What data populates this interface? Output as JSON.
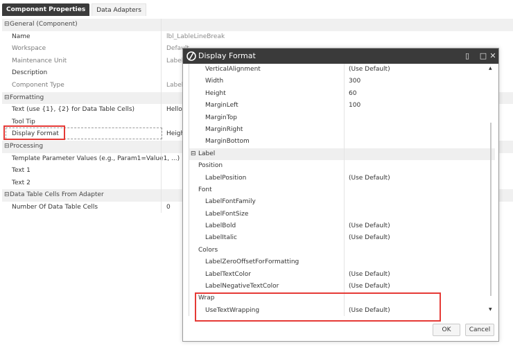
{
  "tabs": [
    {
      "label": "Component Properties"
    },
    {
      "label": "Data Adapters"
    }
  ],
  "properties": {
    "general": {
      "label": "General (Component)",
      "rows": [
        {
          "name": "Name",
          "value": "lbl_LableLineBreak"
        },
        {
          "name": "Workspace",
          "value": "Default"
        },
        {
          "name": "Maintenance Unit",
          "value": "Label"
        },
        {
          "name": "Description",
          "value": ""
        },
        {
          "name": "Component Type",
          "value": "Label"
        }
      ]
    },
    "formatting": {
      "label": "Formatting",
      "rows": [
        {
          "name": "Text (use {1}, {2} for Data Table Cells)",
          "value": "Hello,"
        },
        {
          "name": "Tool Tip",
          "value": ""
        },
        {
          "name": "Display Format",
          "value": "Heigh"
        }
      ]
    },
    "processing": {
      "label": "Processing",
      "rows": [
        {
          "name": "Template Parameter Values (e.g., Param1=Value1, ...)",
          "value": ""
        },
        {
          "name": "Text 1",
          "value": ""
        },
        {
          "name": "Text 2",
          "value": ""
        }
      ]
    },
    "datatable": {
      "label": "Data Table Cells From Adapter",
      "rows": [
        {
          "name": "Number Of Data Table Cells",
          "value": "0"
        }
      ]
    }
  },
  "dialog": {
    "title": "Display Format",
    "rows": {
      "vertical_alignment": {
        "name": "VerticalAlignment",
        "value": "(Use Default)"
      },
      "width": {
        "name": "Width",
        "value": "300"
      },
      "height": {
        "name": "Height",
        "value": "60"
      },
      "margin_left": {
        "name": "MarginLeft",
        "value": "100"
      },
      "margin_top": {
        "name": "MarginTop",
        "value": ""
      },
      "margin_right": {
        "name": "MarginRight",
        "value": ""
      },
      "margin_bottom": {
        "name": "MarginBottom",
        "value": ""
      },
      "label_category": "Label",
      "position_group": "Position",
      "label_position": {
        "name": "LabelPosition",
        "value": "(Use Default)"
      },
      "font_group": "Font",
      "label_font_family": {
        "name": "LabelFontFamily",
        "value": ""
      },
      "label_font_size": {
        "name": "LabelFontSize",
        "value": ""
      },
      "label_bold": {
        "name": "LabelBold",
        "value": "(Use Default)"
      },
      "label_italic": {
        "name": "LabelItalic",
        "value": "(Use Default)"
      },
      "colors_group": "Colors",
      "label_zero_offset": {
        "name": "LabelZeroOffsetForFormatting",
        "value": ""
      },
      "label_text_color": {
        "name": "LabelTextColor",
        "value": "(Use Default)"
      },
      "label_negative_text_color": {
        "name": "LabelNegativeTextColor",
        "value": "(Use Default)"
      },
      "wrap_group": "Wrap",
      "use_text_wrapping": {
        "name": "UseTextWrapping",
        "value": "(Use Default)"
      }
    },
    "ok_label": "OK",
    "cancel_label": "Cancel"
  },
  "glyphs": {
    "collapse": "⊟",
    "restore": "▯",
    "maximize": "□",
    "close": "✕",
    "up": "▲",
    "down": "▼"
  },
  "icons": {
    "title_logo": "onestream-logo-icon",
    "restore": "restore-icon",
    "maximize": "maximize-icon",
    "close": "close-icon"
  },
  "colors": {
    "highlight": "#e53935",
    "title_bar": "#3a3a3a",
    "active_tab": "#3b3b3b"
  }
}
